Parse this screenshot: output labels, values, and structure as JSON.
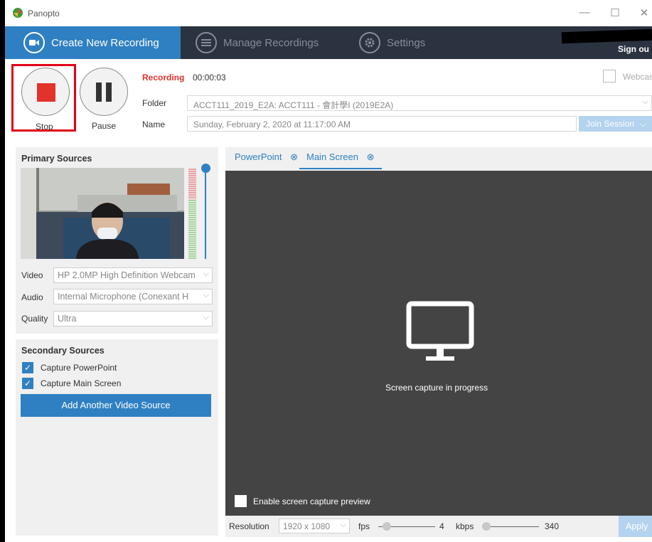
{
  "window": {
    "title": "Panopto",
    "minimize": "—",
    "maximize": "☐",
    "close": "✕"
  },
  "nav": {
    "tabs": [
      {
        "label": "Create New Recording",
        "icon": "video-camera-icon"
      },
      {
        "label": "Manage Recordings",
        "icon": "list-icon"
      },
      {
        "label": "Settings",
        "icon": "gear-icon"
      }
    ],
    "sign_out": "Sign ou"
  },
  "recorder": {
    "stop_label": "Stop",
    "pause_label": "Pause",
    "status_label": "Recording",
    "timer": "00:00:03",
    "folder_label": "Folder",
    "folder_value": "ACCT111_2019_E2A: ACCT111 - 會計學I (2019E2A)",
    "name_label": "Name",
    "name_value": "Sunday, February 2, 2020 at 11:17:00 AM",
    "join_session": "Join Session",
    "webcast_label": "Webcas"
  },
  "primary": {
    "title": "Primary Sources",
    "video_label": "Video",
    "video_value": "HP 2.0MP High Definition Webcam",
    "audio_label": "Audio",
    "audio_value": "Internal Microphone (Conexant H",
    "quality_label": "Quality",
    "quality_value": "Ultra"
  },
  "secondary": {
    "title": "Secondary Sources",
    "items": [
      {
        "label": "Capture PowerPoint",
        "checked": true
      },
      {
        "label": "Capture Main Screen",
        "checked": true
      }
    ],
    "add_button": "Add Another Video Source"
  },
  "preview": {
    "tabs": [
      {
        "label": "PowerPoint"
      },
      {
        "label": "Main Screen"
      }
    ],
    "message": "Screen capture in progress",
    "enable_preview": "Enable screen capture preview"
  },
  "footer": {
    "resolution_label": "Resolution",
    "resolution_value": "1920 x 1080",
    "fps_label": "fps",
    "fps_value": "4",
    "kbps_label": "kbps",
    "kbps_value": "340",
    "apply": "Apply"
  },
  "colors": {
    "accent": "#2f80c2",
    "nav": "#2b3240",
    "record": "#e2322b",
    "highlight": "#e2001a"
  }
}
